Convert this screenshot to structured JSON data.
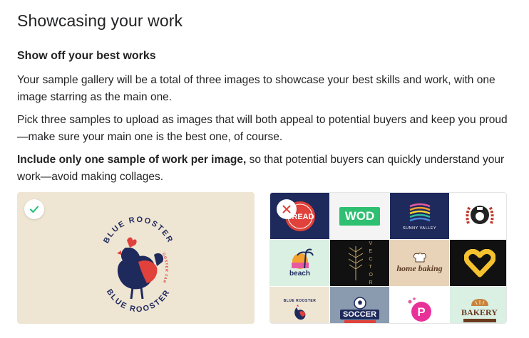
{
  "section": {
    "title": "Showcasing your work",
    "subtitle": "Show off your best works",
    "paragraph1": "Your sample gallery will be a total of three images to showcase your best skills and work, with one image starring as the main one.",
    "paragraph2": "Pick three samples to upload as images that will both appeal to potential buyers and keep you proud—make sure your main one is the best one, of course.",
    "paragraph3_bold": "Include only one sample of work per image,",
    "paragraph3_rest": " so that potential buyers can quickly understand your work—avoid making collages."
  },
  "good_example": {
    "badge_icon": "check-icon",
    "logo_top_text": "BLUE ROOSTER",
    "logo_bottom_text": "BLUE ROOSTER",
    "logo_side_text": "ROOSTER FARM",
    "colors": {
      "background": "#efe5d3",
      "navy": "#1f2a5c",
      "red": "#e0413a",
      "check": "#1dbf73"
    }
  },
  "bad_example": {
    "badge_icon": "close-x-icon",
    "tiles": [
      {
        "name": "tile-bread",
        "text": "BREAD"
      },
      {
        "name": "tile-wod",
        "text": "WOD"
      },
      {
        "name": "tile-sunny-valley",
        "text": "SUNNY VALLEY"
      },
      {
        "name": "tile-fitness",
        "text": ""
      },
      {
        "name": "tile-beach",
        "text": "beach"
      },
      {
        "name": "tile-vector",
        "text": "V E C T O R"
      },
      {
        "name": "tile-home-baking",
        "text": "home baking"
      },
      {
        "name": "tile-heart",
        "text": ""
      },
      {
        "name": "tile-blue-rooster-mini",
        "text": "BLUE ROOSTER"
      },
      {
        "name": "tile-soccer",
        "text": "SOCCER"
      },
      {
        "name": "tile-p-logo",
        "text": "P"
      },
      {
        "name": "tile-bakery",
        "text": "BAKERY"
      }
    ],
    "colors": {
      "x": "#e0413a"
    }
  }
}
